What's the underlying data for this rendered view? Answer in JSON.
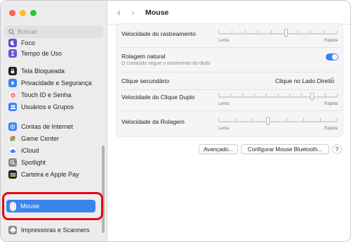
{
  "window": {
    "title": "Mouse"
  },
  "sidebar": {
    "search_placeholder": "Buscar",
    "items": [
      {
        "label": "Foco",
        "icon": "moon-icon",
        "color": "#5a4fcf"
      },
      {
        "label": "Tempo de Uso",
        "icon": "hourglass-icon",
        "color": "#6e54d8"
      },
      {
        "label": "Tela Bloqueada",
        "icon": "lock-screen-icon",
        "color": "#1f1f1f"
      },
      {
        "label": "Privacidade e Segurança",
        "icon": "hand-icon",
        "color": "#3b82f6"
      },
      {
        "label": "Touch ID e Senha",
        "icon": "fingerprint-icon",
        "color": "#ef4d6b"
      },
      {
        "label": "Usuários e Grupos",
        "icon": "users-icon",
        "color": "#3b82f6"
      },
      {
        "label": "Contas de Internet",
        "icon": "at-icon",
        "color": "#3b82f6"
      },
      {
        "label": "Game Center",
        "icon": "game-center-icon",
        "color": "#e8e8e8"
      },
      {
        "label": "iCloud",
        "icon": "cloud-icon",
        "color": "#3b82f6"
      },
      {
        "label": "Spotlight",
        "icon": "magnifier-icon",
        "color": "#8a8a8a"
      },
      {
        "label": "Carteira e Apple Pay",
        "icon": "wallet-icon",
        "color": "#1f1f1f"
      },
      {
        "label": "Mouse",
        "icon": "mouse-icon",
        "color": "#ffffff"
      },
      {
        "label": "Impressoras e Scanners",
        "icon": "printer-icon",
        "color": "#8a8a8a"
      }
    ]
  },
  "main": {
    "tracking_speed": {
      "label": "Velocidade do rastreamento",
      "min": "Lenta",
      "max": "Rápida",
      "value": 0.57
    },
    "natural_scroll": {
      "label": "Rolagem natural",
      "sub": "O conteúdo segue o movimento do dedo",
      "on": true
    },
    "secondary_click": {
      "label": "Clique secundário",
      "value": "Clique no Lado Direito"
    },
    "double_click_speed": {
      "label": "Velocidade do Clique Duplo",
      "min": "Lenta",
      "max": "Rápida",
      "value": 0.79
    },
    "scroll_speed": {
      "label": "Velocidade da Rolagem",
      "min": "Lenta",
      "max": "Rápida",
      "value": 0.42
    },
    "buttons": {
      "advanced": "Avançado...",
      "bluetooth": "Configurar Mouse Bluetooth...",
      "help": "?"
    }
  },
  "colors": {
    "accent": "#3a84ee",
    "highlight": "#e30613"
  }
}
